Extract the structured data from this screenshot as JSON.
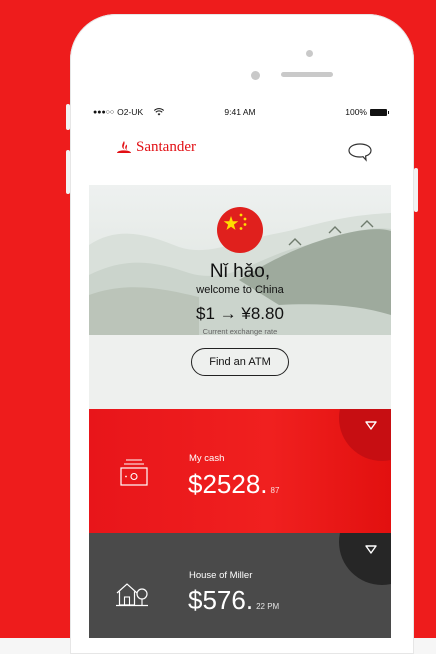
{
  "status_bar": {
    "carrier": "O2-UK",
    "time": "9:41 AM",
    "battery": "100%"
  },
  "header": {
    "brand": "Santander"
  },
  "hero": {
    "greeting": "Nǐ hǎo,",
    "welcome": "welcome to China",
    "exchange_rate": "$1 → ¥8.80",
    "exchange_label": "Current exchange rate",
    "atm_button": "Find an ATM"
  },
  "accounts": [
    {
      "name": "My cash",
      "amount": "$2528.",
      "amount_sub": "87"
    },
    {
      "name": "House of Miller",
      "amount": "$576.",
      "amount_sub": "22 PM"
    }
  ],
  "colors": {
    "brand_red": "#ec1c1c",
    "card_dark": "#4a4a4a"
  },
  "icons": [
    "signal-icon",
    "wifi-icon",
    "battery-icon",
    "santander-flame-icon",
    "chat-bubble-icon",
    "china-flag-icon",
    "chevron-down-icon",
    "cash-icon",
    "house-tree-icon"
  ]
}
